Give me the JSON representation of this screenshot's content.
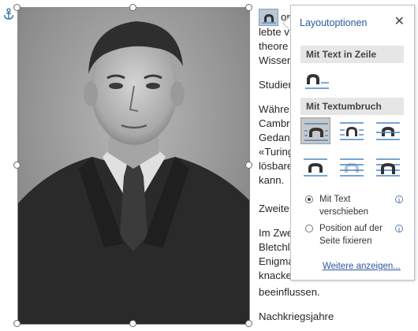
{
  "document": {
    "lines": [
      "ors",
      "lebte v",
      "theore",
      "Wissen",
      "Studier",
      "Währe",
      "Cambr",
      "Gedank",
      "«Turing",
      "lösbare",
      "kann.",
      "Zweite",
      "Im Zwe",
      "Bletchl",
      "Enigma",
      "knacke",
      "beeinflussen.",
      "Nachkriegsjahre"
    ]
  },
  "layout_popup": {
    "title": "Layoutoptionen",
    "close_label": "✕",
    "section_inline": "Mit Text in Zeile",
    "section_wrap": "Mit Textumbruch",
    "radio_move": "Mit Text verschieben",
    "radio_move_mnemonic": "M",
    "radio_fix": "Position auf der Seite fixieren",
    "radio_fix_mnemonic": "P",
    "selected_radio": "radio_move",
    "more_link": "Weitere anzeigen...",
    "info_symbol": "i"
  },
  "icons": {
    "anchor": "anchor-icon",
    "layout_trigger": "layout-options-icon"
  },
  "colors": {
    "accent": "#2b579a",
    "section_bg": "#e6e6e6",
    "selected_option_bg": "#c8c8c8",
    "trigger_bg": "#b9c7d6",
    "wrap_line": "#4a86c8"
  }
}
